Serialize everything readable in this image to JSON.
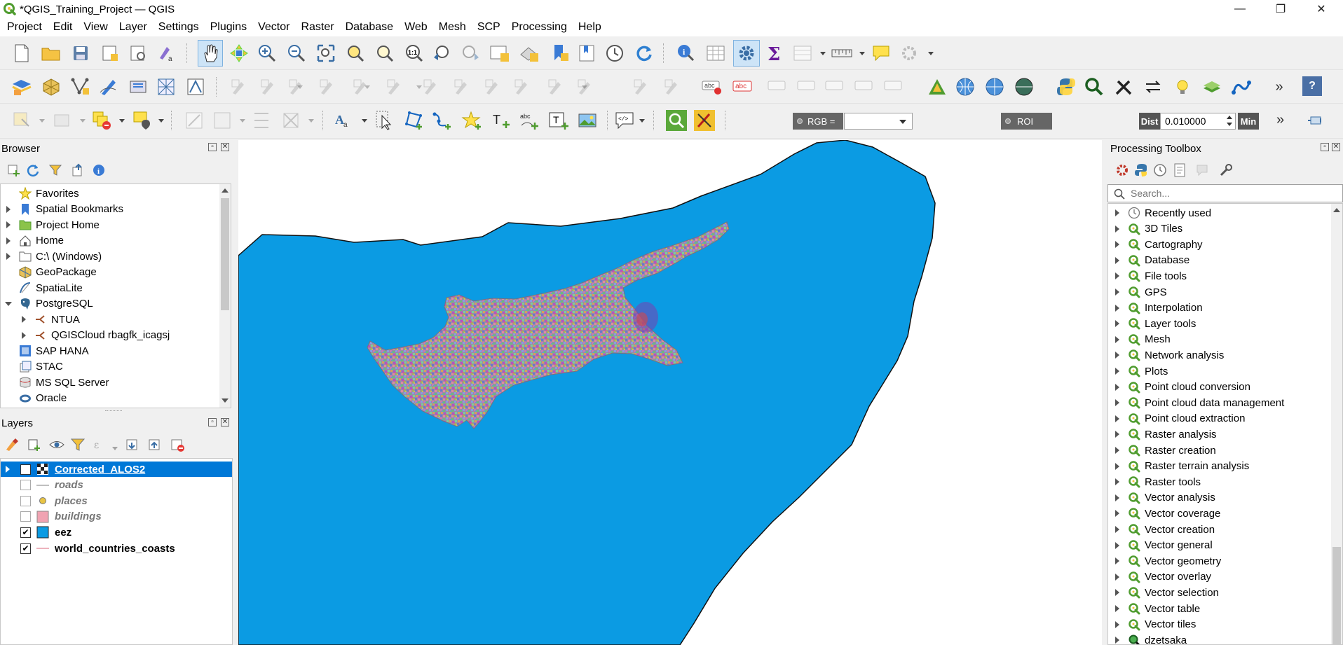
{
  "window": {
    "title": "*QGIS_Training_Project — QGIS",
    "minimize": "—",
    "maximize": "❐",
    "close": "✕"
  },
  "menu": [
    "Project",
    "Edit",
    "View",
    "Layer",
    "Settings",
    "Plugins",
    "Vector",
    "Raster",
    "Database",
    "Web",
    "Mesh",
    "SCP",
    "Processing",
    "Help"
  ],
  "toolbar3": {
    "rgb_label": "RGB =",
    "roi_label": "ROI",
    "dist_label": "Dist",
    "dist_value": "0.010000",
    "min_label": "Min",
    "more": "»"
  },
  "browser": {
    "title": "Browser",
    "items": [
      {
        "label": "Favorites",
        "icon": "star-icon",
        "expand": "none",
        "indent": 0
      },
      {
        "label": "Spatial Bookmarks",
        "icon": "bookmark-icon",
        "expand": "closed",
        "indent": 0
      },
      {
        "label": "Project Home",
        "icon": "project-folder-icon",
        "expand": "closed",
        "indent": 0
      },
      {
        "label": "Home",
        "icon": "home-icon",
        "expand": "closed",
        "indent": 0
      },
      {
        "label": "C:\\ (Windows)",
        "icon": "folder-icon",
        "expand": "closed",
        "indent": 0
      },
      {
        "label": "GeoPackage",
        "icon": "geopackage-icon",
        "expand": "none",
        "indent": 0
      },
      {
        "label": "SpatiaLite",
        "icon": "spatialite-icon",
        "expand": "none",
        "indent": 0
      },
      {
        "label": "PostgreSQL",
        "icon": "postgresql-icon",
        "expand": "open",
        "indent": 0
      },
      {
        "label": "NTUA",
        "icon": "connection-icon",
        "expand": "closed",
        "indent": 1
      },
      {
        "label": "QGISCloud rbagfk_icagsj",
        "icon": "connection-icon",
        "expand": "closed",
        "indent": 1
      },
      {
        "label": "SAP HANA",
        "icon": "sap-hana-icon",
        "expand": "none",
        "indent": 0
      },
      {
        "label": "STAC",
        "icon": "stac-icon",
        "expand": "none",
        "indent": 0
      },
      {
        "label": "MS SQL Server",
        "icon": "mssql-icon",
        "expand": "none",
        "indent": 0
      },
      {
        "label": "Oracle",
        "icon": "oracle-icon",
        "expand": "none",
        "indent": 0
      }
    ]
  },
  "layers": {
    "title": "Layers",
    "items": [
      {
        "label": "Corrected_ALOS2",
        "checked": true,
        "selected": true,
        "style": "raster",
        "bold": true,
        "italic": false
      },
      {
        "label": "roads",
        "checked": false,
        "selected": false,
        "style": "line-gray",
        "bold": true,
        "italic": true
      },
      {
        "label": "places",
        "checked": false,
        "selected": false,
        "style": "point",
        "bold": true,
        "italic": true
      },
      {
        "label": "buildings",
        "checked": false,
        "selected": false,
        "style": "polygon-pink",
        "bold": true,
        "italic": true
      },
      {
        "label": "eez",
        "checked": true,
        "selected": false,
        "style": "polygon-blue",
        "bold": true,
        "italic": false
      },
      {
        "label": "world_countries_coasts",
        "checked": true,
        "selected": false,
        "style": "line-pink",
        "bold": true,
        "italic": false
      }
    ]
  },
  "processing": {
    "title": "Processing Toolbox",
    "search_placeholder": "Search...",
    "items": [
      {
        "label": "Recently used",
        "icon": "clock-icon"
      },
      {
        "label": "3D Tiles",
        "icon": "qgis-icon"
      },
      {
        "label": "Cartography",
        "icon": "qgis-icon"
      },
      {
        "label": "Database",
        "icon": "qgis-icon"
      },
      {
        "label": "File tools",
        "icon": "qgis-icon"
      },
      {
        "label": "GPS",
        "icon": "qgis-icon"
      },
      {
        "label": "Interpolation",
        "icon": "qgis-icon"
      },
      {
        "label": "Layer tools",
        "icon": "qgis-icon"
      },
      {
        "label": "Mesh",
        "icon": "qgis-icon"
      },
      {
        "label": "Network analysis",
        "icon": "qgis-icon"
      },
      {
        "label": "Plots",
        "icon": "qgis-icon"
      },
      {
        "label": "Point cloud conversion",
        "icon": "qgis-icon"
      },
      {
        "label": "Point cloud data management",
        "icon": "qgis-icon"
      },
      {
        "label": "Point cloud extraction",
        "icon": "qgis-icon"
      },
      {
        "label": "Raster analysis",
        "icon": "qgis-icon"
      },
      {
        "label": "Raster creation",
        "icon": "qgis-icon"
      },
      {
        "label": "Raster terrain analysis",
        "icon": "qgis-icon"
      },
      {
        "label": "Raster tools",
        "icon": "qgis-icon"
      },
      {
        "label": "Vector analysis",
        "icon": "qgis-icon"
      },
      {
        "label": "Vector coverage",
        "icon": "qgis-icon"
      },
      {
        "label": "Vector creation",
        "icon": "qgis-icon"
      },
      {
        "label": "Vector general",
        "icon": "qgis-icon"
      },
      {
        "label": "Vector geometry",
        "icon": "qgis-icon"
      },
      {
        "label": "Vector overlay",
        "icon": "qgis-icon"
      },
      {
        "label": "Vector selection",
        "icon": "qgis-icon"
      },
      {
        "label": "Vector table",
        "icon": "qgis-icon"
      },
      {
        "label": "Vector tiles",
        "icon": "qgis-icon"
      },
      {
        "label": "dzetsaka",
        "icon": "magnifier-icon"
      }
    ]
  },
  "colors": {
    "eez_fill": "#0b9be3",
    "selection": "#0078d7",
    "qgis_green": "#4f9c2f",
    "buildings_fill": "#f0a3b2"
  }
}
